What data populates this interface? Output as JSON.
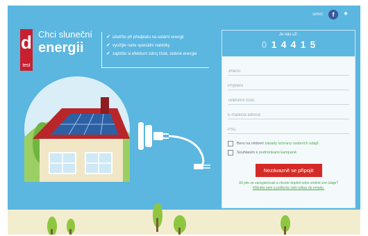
{
  "share": {
    "label": "sdílet:",
    "facebook_icon": "facebook-icon",
    "twitter_icon": "twitter-icon"
  },
  "brand": {
    "logo_letter": "d",
    "logo_sub": "test",
    "headline_line1": "Chci sluneční",
    "headline_line2": "energii",
    "logo_color": "#c8202f"
  },
  "benefits": [
    "ušetříte při předplatu na solární energii",
    "využijte naše speciální nabídky",
    "zajistíte si efektivní zdroj čisté, zelené energie"
  ],
  "form": {
    "counter_label": "Je nás už:",
    "counter_digits": [
      "0",
      "1",
      "4",
      "4",
      "1",
      "5"
    ],
    "fields": [
      {
        "placeholder": "Jméno"
      },
      {
        "placeholder": "Příjmení"
      },
      {
        "placeholder": "Telefonní číslo"
      },
      {
        "placeholder": "E-mailová adresa"
      },
      {
        "placeholder": "PSČ"
      }
    ],
    "consent1_prefix": "Beru na vědomí ",
    "consent1_link": "zásady ochrany osobních údajů",
    "consent2_prefix": "Souhlasím s ",
    "consent2_link": "podmínkami kampaně",
    "submit_label": "Nezávazně se připojit",
    "note_line1": "Již jste se zaregistrovali a chcete doplnit nebo změnit své údaje?",
    "note_line2": "Klikněte sem a pošleme vám odkaz do emailu."
  },
  "colors": {
    "sky": "#5bb6e0",
    "ground": "#f3edcf",
    "accent_red": "#d42a26",
    "link_green": "#4aa84a"
  }
}
